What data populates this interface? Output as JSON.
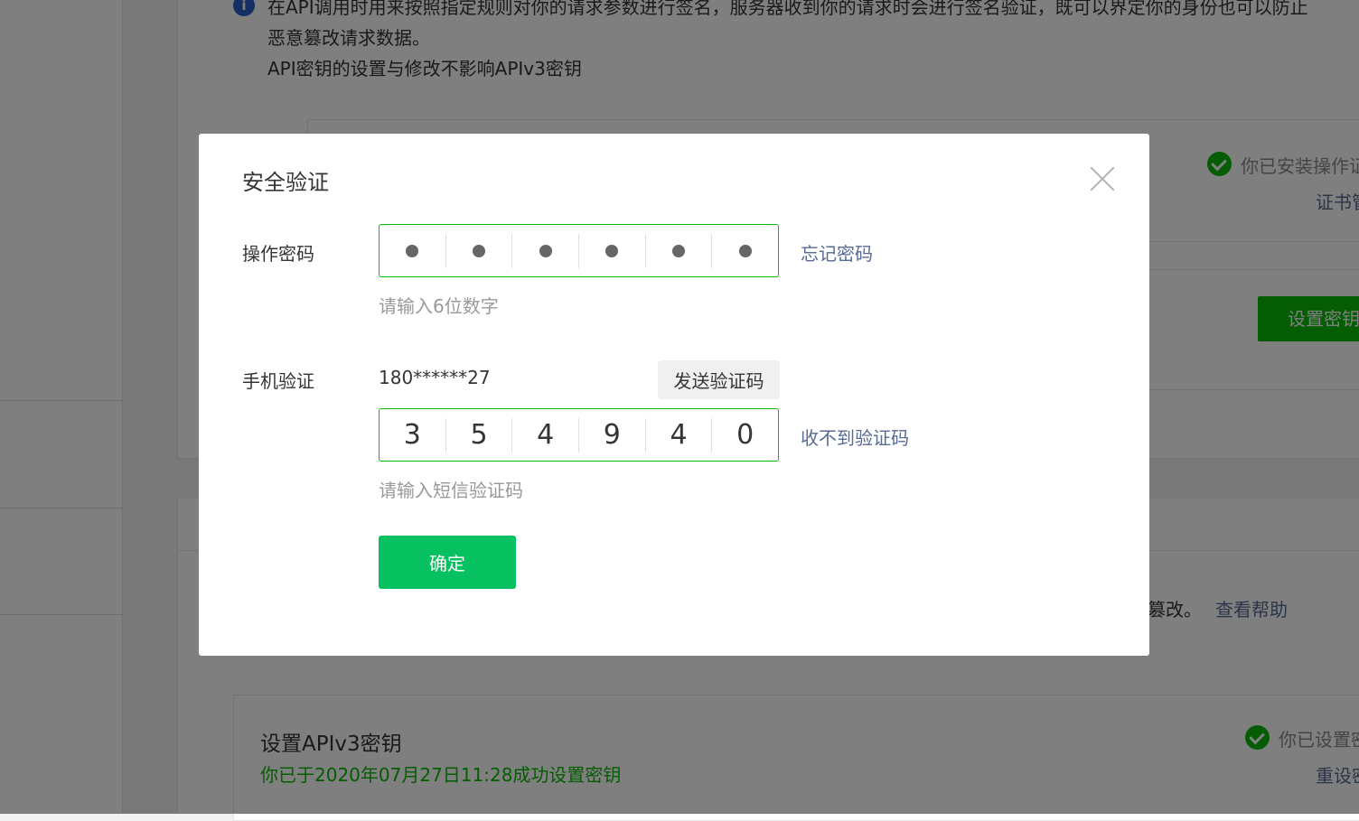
{
  "background": {
    "info_line1": "在API调用时用来按照指定规则对你的请求参数进行签名，服务器收到你的请求时会进行签名验证，既可以界定你的身份也可以防止",
    "info_line2": "恶意篡改请求数据。",
    "info_line3": "API密钥的设置与修改不影响APIv3密钥",
    "status_installed": "你已安装操作证书",
    "cert_link": "证书管理",
    "set_key_button": "设置密钥",
    "tamper_text": "篡改。",
    "help_link": "查看帮助",
    "apiv3_title": "设置APIv3密钥",
    "apiv3_status": "你已于2020年07月27日11:28成功设置密钥",
    "apiv3_set_status": "你已设置密钥",
    "reset_link": "重设密钥"
  },
  "modal": {
    "title": "安全验证",
    "password_label": "操作密码",
    "password_cells": [
      "●",
      "●",
      "●",
      "●",
      "●",
      "●"
    ],
    "forgot_link": "忘记密码",
    "password_hint": "请输入6位数字",
    "phone_label": "手机验证",
    "phone_number": "180******27",
    "send_code_button": "发送验证码",
    "sms_digits": [
      "3",
      "5",
      "4",
      "9",
      "4",
      "0"
    ],
    "no_code_link": "收不到验证码",
    "sms_hint": "请输入短信验证码",
    "confirm_button": "确定"
  },
  "colors": {
    "accent_green": "#07c160",
    "link_blue": "#576b95",
    "overlay": "rgba(0,0,0,0.5)"
  }
}
